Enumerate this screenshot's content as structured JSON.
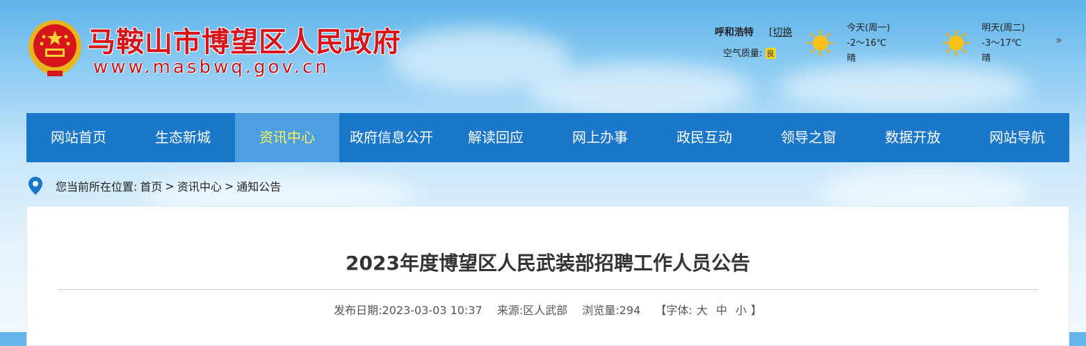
{
  "header": {
    "site_title": "马鞍山市博望区人民政府",
    "site_url": "www.masbwq.gov.cn",
    "brand_color": "#d7161b"
  },
  "weather": {
    "city": "呼和浩特",
    "switch_prefix": "[",
    "switch_label": "切换",
    "air_quality_label": "空气质量:",
    "air_quality_value": "良",
    "today": {
      "label": "今天(周一)",
      "temp": "-2～16℃",
      "condition": "晴",
      "icon": "sun-icon"
    },
    "tomorrow": {
      "label": "明天(周二)",
      "temp": "-3～17℃",
      "condition": "晴",
      "icon": "sun-icon"
    },
    "more_icon": "double-chevron-right-icon",
    "more_glyph": "»"
  },
  "nav": {
    "accent": "#1a77c9",
    "active_color": "#fff35a",
    "items": [
      {
        "label": "网站首页"
      },
      {
        "label": "生态新城"
      },
      {
        "label": "资讯中心",
        "active": true
      },
      {
        "label": "政府信息公开"
      },
      {
        "label": "解读回应"
      },
      {
        "label": "网上办事"
      },
      {
        "label": "政民互动"
      },
      {
        "label": "领导之窗"
      },
      {
        "label": "数据开放"
      },
      {
        "label": "网站导航"
      }
    ]
  },
  "breadcrumb": {
    "prefix": "您当前所在位置:",
    "items": [
      "首页",
      "资讯中心",
      "通知公告"
    ],
    "separator": ">",
    "icon": "location-pin-icon"
  },
  "article": {
    "title": "2023年度博望区人民武装部招聘工作人员公告",
    "publish_date_label": "发布日期:",
    "publish_date": "2023-03-03 10:37",
    "source_label": "来源:",
    "source": "区人武部",
    "views_label": "浏览量:",
    "views": "294",
    "font_label_open": "【字体:",
    "font_large": "大",
    "font_medium": "中",
    "font_small": "小",
    "font_label_close": "】"
  }
}
